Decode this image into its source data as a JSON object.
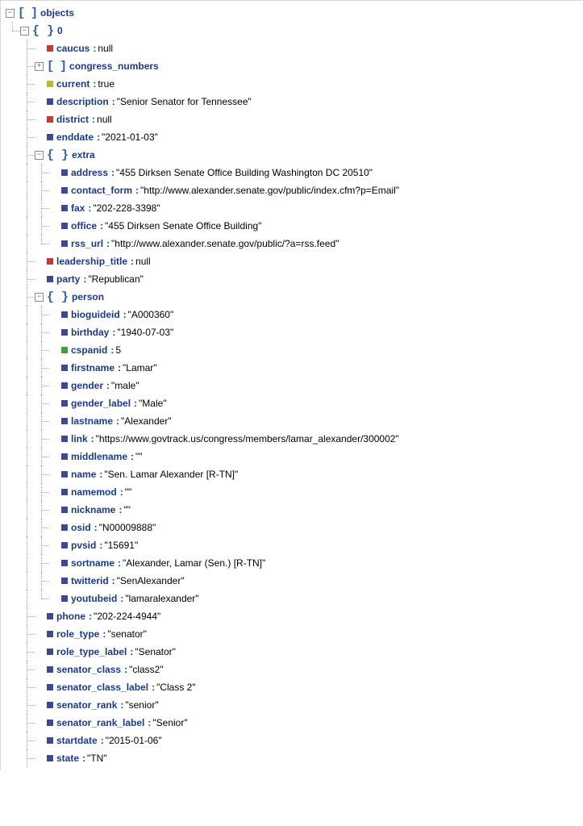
{
  "tree": [
    {
      "depth": 0,
      "guides": "",
      "toggle": "minus",
      "icon": "array",
      "key": "objects"
    },
    {
      "depth": 1,
      "guides": "e",
      "toggle": "minus",
      "icon": "obj",
      "key": "0"
    },
    {
      "depth": 2,
      "guides": "bt",
      "toggle": "",
      "icon": "null",
      "key": "caucus",
      "val": "null"
    },
    {
      "depth": 2,
      "guides": "bt",
      "toggle": "plus",
      "icon": "array",
      "key": "congress_numbers"
    },
    {
      "depth": 2,
      "guides": "bt",
      "toggle": "",
      "icon": "bool",
      "key": "current",
      "val": "true"
    },
    {
      "depth": 2,
      "guides": "bt",
      "toggle": "",
      "icon": "str",
      "key": "description",
      "val": "\"Senior Senator for Tennessee\""
    },
    {
      "depth": 2,
      "guides": "bt",
      "toggle": "",
      "icon": "null",
      "key": "district",
      "val": "null"
    },
    {
      "depth": 2,
      "guides": "bt",
      "toggle": "",
      "icon": "str",
      "key": "enddate",
      "val": "\"2021-01-03\""
    },
    {
      "depth": 2,
      "guides": "bt",
      "toggle": "minus",
      "icon": "obj",
      "key": "extra"
    },
    {
      "depth": 3,
      "guides": "bvt",
      "toggle": "",
      "icon": "str",
      "key": "address",
      "val": "\"455 Dirksen Senate Office Building Washington DC 20510\""
    },
    {
      "depth": 3,
      "guides": "bvt",
      "toggle": "",
      "icon": "str",
      "key": "contact_form",
      "val": "\"http://www.alexander.senate.gov/public/index.cfm?p=Email\""
    },
    {
      "depth": 3,
      "guides": "bvt",
      "toggle": "",
      "icon": "str",
      "key": "fax",
      "val": "\"202-228-3398\""
    },
    {
      "depth": 3,
      "guides": "bvt",
      "toggle": "",
      "icon": "str",
      "key": "office",
      "val": "\"455 Dirksen Senate Office Building\""
    },
    {
      "depth": 3,
      "guides": "bve",
      "toggle": "",
      "icon": "str",
      "key": "rss_url",
      "val": "\"http://www.alexander.senate.gov/public/?a=rss.feed\""
    },
    {
      "depth": 2,
      "guides": "bt",
      "toggle": "",
      "icon": "null",
      "key": "leadership_title",
      "val": "null"
    },
    {
      "depth": 2,
      "guides": "bt",
      "toggle": "",
      "icon": "str",
      "key": "party",
      "val": "\"Republican\""
    },
    {
      "depth": 2,
      "guides": "bt",
      "toggle": "minus",
      "icon": "obj",
      "key": "person"
    },
    {
      "depth": 3,
      "guides": "bvt",
      "toggle": "",
      "icon": "str",
      "key": "bioguideid",
      "val": "\"A000360\""
    },
    {
      "depth": 3,
      "guides": "bvt",
      "toggle": "",
      "icon": "str",
      "key": "birthday",
      "val": "\"1940-07-03\""
    },
    {
      "depth": 3,
      "guides": "bvt",
      "toggle": "",
      "icon": "int",
      "key": "cspanid",
      "val": "5"
    },
    {
      "depth": 3,
      "guides": "bvt",
      "toggle": "",
      "icon": "str",
      "key": "firstname",
      "val": "\"Lamar\""
    },
    {
      "depth": 3,
      "guides": "bvt",
      "toggle": "",
      "icon": "str",
      "key": "gender",
      "val": "\"male\""
    },
    {
      "depth": 3,
      "guides": "bvt",
      "toggle": "",
      "icon": "str",
      "key": "gender_label",
      "val": "\"Male\""
    },
    {
      "depth": 3,
      "guides": "bvt",
      "toggle": "",
      "icon": "str",
      "key": "lastname",
      "val": "\"Alexander\""
    },
    {
      "depth": 3,
      "guides": "bvt",
      "toggle": "",
      "icon": "str",
      "key": "link",
      "val": "\"https://www.govtrack.us/congress/members/lamar_alexander/300002\""
    },
    {
      "depth": 3,
      "guides": "bvt",
      "toggle": "",
      "icon": "str",
      "key": "middlename",
      "val": "\"\""
    },
    {
      "depth": 3,
      "guides": "bvt",
      "toggle": "",
      "icon": "str",
      "key": "name",
      "val": "\"Sen. Lamar Alexander [R-TN]\""
    },
    {
      "depth": 3,
      "guides": "bvt",
      "toggle": "",
      "icon": "str",
      "key": "namemod",
      "val": "\"\""
    },
    {
      "depth": 3,
      "guides": "bvt",
      "toggle": "",
      "icon": "str",
      "key": "nickname",
      "val": "\"\""
    },
    {
      "depth": 3,
      "guides": "bvt",
      "toggle": "",
      "icon": "str",
      "key": "osid",
      "val": "\"N00009888\""
    },
    {
      "depth": 3,
      "guides": "bvt",
      "toggle": "",
      "icon": "str",
      "key": "pvsid",
      "val": "\"15691\""
    },
    {
      "depth": 3,
      "guides": "bvt",
      "toggle": "",
      "icon": "str",
      "key": "sortname",
      "val": "\"Alexander, Lamar (Sen.) [R-TN]\""
    },
    {
      "depth": 3,
      "guides": "bvt",
      "toggle": "",
      "icon": "str",
      "key": "twitterid",
      "val": "\"SenAlexander\""
    },
    {
      "depth": 3,
      "guides": "bve",
      "toggle": "",
      "icon": "str",
      "key": "youtubeid",
      "val": "\"lamaralexander\""
    },
    {
      "depth": 2,
      "guides": "bt",
      "toggle": "",
      "icon": "str",
      "key": "phone",
      "val": "\"202-224-4944\""
    },
    {
      "depth": 2,
      "guides": "bt",
      "toggle": "",
      "icon": "str",
      "key": "role_type",
      "val": "\"senator\""
    },
    {
      "depth": 2,
      "guides": "bt",
      "toggle": "",
      "icon": "str",
      "key": "role_type_label",
      "val": "\"Senator\""
    },
    {
      "depth": 2,
      "guides": "bt",
      "toggle": "",
      "icon": "str",
      "key": "senator_class",
      "val": "\"class2\""
    },
    {
      "depth": 2,
      "guides": "bt",
      "toggle": "",
      "icon": "str",
      "key": "senator_class_label",
      "val": "\"Class 2\""
    },
    {
      "depth": 2,
      "guides": "bt",
      "toggle": "",
      "icon": "str",
      "key": "senator_rank",
      "val": "\"senior\""
    },
    {
      "depth": 2,
      "guides": "bt",
      "toggle": "",
      "icon": "str",
      "key": "senator_rank_label",
      "val": "\"Senior\""
    },
    {
      "depth": 2,
      "guides": "bt",
      "toggle": "",
      "icon": "str",
      "key": "startdate",
      "val": "\"2015-01-06\""
    },
    {
      "depth": 2,
      "guides": "bt",
      "toggle": "",
      "icon": "str",
      "key": "state",
      "val": "\"TN\""
    }
  ]
}
